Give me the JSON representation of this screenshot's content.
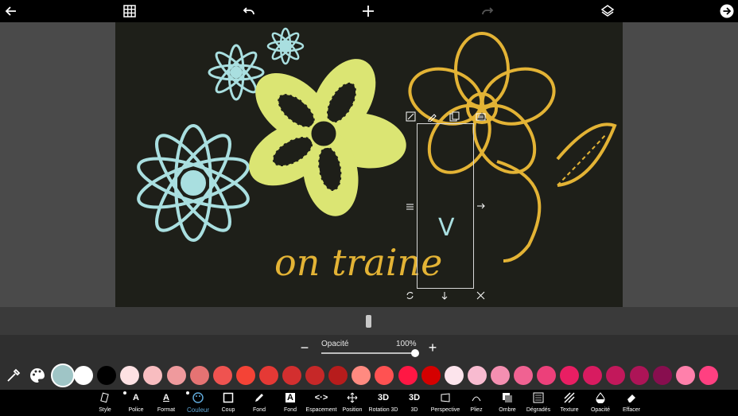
{
  "topbar": {
    "back_icon": "arrow-left-icon",
    "grid_icon": "grid-icon",
    "undo_icon": "undo-icon",
    "add_icon": "plus-icon",
    "redo_icon": "redo-icon",
    "layers_icon": "layers-icon",
    "next_icon": "arrow-right-circle-icon"
  },
  "canvas": {
    "text": "on traine",
    "selected_text": "V",
    "colors": {
      "background": "#1e1f19",
      "blue": "#a9dfe0",
      "green": "#dbe573",
      "yellow": "#e3b335"
    }
  },
  "opacity": {
    "label": "Opacité",
    "value": "100%",
    "level": 1.0,
    "minus": "−",
    "plus": "+"
  },
  "palette": {
    "selected": "#9fc5c6",
    "colors": [
      "#9fc5c6",
      "#ffffff",
      "#000000",
      "#fde1e3",
      "#f8bdc0",
      "#ef9a9d",
      "#e57373",
      "#ef5350",
      "#f44336",
      "#e53935",
      "#d32f2f",
      "#c62828",
      "#b71c1c",
      "#ff8a80",
      "#ff5252",
      "#ff1744",
      "#d50000",
      "#fce4ec",
      "#f8bbd0",
      "#f48fb1",
      "#f06292",
      "#ec407a",
      "#e91e63",
      "#d81b60",
      "#c2185b",
      "#ad1457",
      "#880e4f",
      "#ff80ab",
      "#ff4081"
    ]
  },
  "tools": [
    {
      "label": "Style",
      "icon": "style-icon"
    },
    {
      "label": "Police",
      "icon": "A"
    },
    {
      "label": "Format",
      "icon": "A"
    },
    {
      "label": "Couleur",
      "icon": "palette-icon"
    },
    {
      "label": "Coup",
      "icon": "square-outline-icon"
    },
    {
      "label": "Fond",
      "icon": "brush-icon"
    },
    {
      "label": "Fond",
      "icon": "A"
    },
    {
      "label": "Espacement",
      "icon": "<·>"
    },
    {
      "label": "Position",
      "icon": "move-icon"
    },
    {
      "label": "Rotation 3D",
      "icon": "3D"
    },
    {
      "label": "3D",
      "icon": "3D"
    },
    {
      "label": "Perspective",
      "icon": "perspective-icon"
    },
    {
      "label": "Pliez",
      "icon": "bend-icon"
    },
    {
      "label": "Ombre",
      "icon": "shadow-icon"
    },
    {
      "label": "Dégradés",
      "icon": "gradient-icon"
    },
    {
      "label": "Texture",
      "icon": "texture-icon"
    },
    {
      "label": "Opacité",
      "icon": "opacity-icon"
    },
    {
      "label": "Effacer",
      "icon": "eraser-icon"
    }
  ]
}
